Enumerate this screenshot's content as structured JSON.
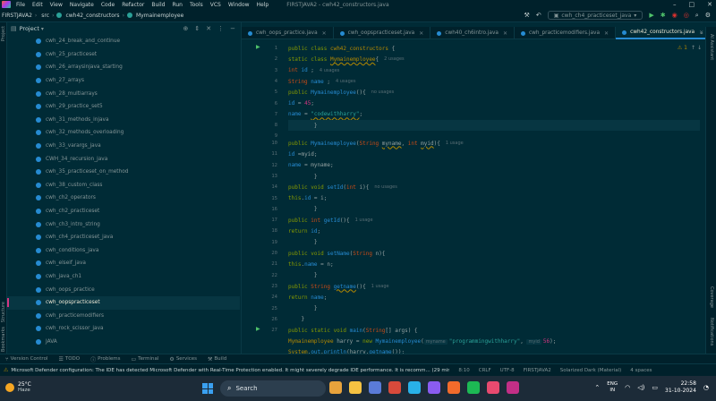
{
  "menubar": {
    "items": [
      "File",
      "Edit",
      "View",
      "Navigate",
      "Code",
      "Refactor",
      "Build",
      "Run",
      "Tools",
      "VCS",
      "Window",
      "Help"
    ],
    "title": "FIRSTJAVA2 - cwh42_constructors.java",
    "controls": [
      "–",
      "□",
      "✕"
    ]
  },
  "navbar": {
    "crumbs": [
      "FIRSTJAVA2",
      "src",
      "cwh42_constructors",
      "Mymainemployee"
    ],
    "run_config": "cwh_ch4_practiceset_java"
  },
  "left_stripe": {
    "project_label": "Project",
    "structure_label": "Structure",
    "bookmarks_label": "Bookmarks"
  },
  "project": {
    "title": "Project",
    "items": [
      "cwh_24_break_and_continue",
      "cwh_25_practiceset",
      "cwh_26_arraysinjava_starting",
      "cwh_27_arrays",
      "cwh_28_multiarrays",
      "cwh_29_practice_set5",
      "cwh_31_methods_injava",
      "cwh_32_methods_overloading",
      "cwh_33_varargs_java",
      "CWH_34_recursion_java",
      "cwh_35_practiceset_on_method",
      "cwh_38_custom_class",
      "cwh_ch2_operators",
      "cwh_ch2_practiceset",
      "cwh_ch3_intro_string",
      "cwh_ch4_practiceset_java",
      "cwh_conditions_java",
      "cwh_elseif_java",
      "cwh_java_ch1",
      "cwh_oops_practice",
      "cwh_oopspracticeset",
      "cwh_practicemodifiers",
      "cwh_rock_scissor_java",
      "JAVA"
    ],
    "selected_index": 20
  },
  "tabs": [
    {
      "label": "cwh_oops_practice.java",
      "active": false
    },
    {
      "label": "cwh_oopspracticeset.java",
      "active": false
    },
    {
      "label": "cwh40_ch6intro.java",
      "active": false
    },
    {
      "label": "cwh_practicemodifiers.java",
      "active": false
    },
    {
      "label": "cwh42_constructors.java",
      "active": true
    }
  ],
  "editor": {
    "line_numbers": [
      "1",
      "2",
      "3",
      "4",
      "5",
      "6",
      "7",
      "8",
      "9",
      "10",
      "11",
      "12",
      "13",
      "14",
      "15",
      "16",
      "17",
      "18",
      "19",
      "20",
      "21",
      "22",
      "23",
      "24",
      "25",
      "26",
      "27"
    ],
    "warning_count": "1",
    "hints": {
      "usages2": "2 usages",
      "usages4": "4 usages",
      "usages4b": "4 usages",
      "nousages": "no usages",
      "usage1": "1 usage",
      "nousages2": "no usages",
      "usage1b": "1 usage",
      "usage1c": "1 usage",
      "usage1d": "1 usage",
      "pname": "myname",
      "pid": "myid"
    },
    "strings": {
      "codewithharry": "\"codewithharry\"",
      "programmingwithharry": "\"programmingwithharry\""
    },
    "numbers": {
      "n45": "45",
      "n56": "56"
    }
  },
  "right_stripe": {
    "ai": "AI Assistant",
    "coverage": "Coverage",
    "notifications": "Notifications"
  },
  "toolwindows": [
    "Version Control",
    "TODO",
    "Problems",
    "Terminal",
    "Services",
    "Build"
  ],
  "status": {
    "message": "Microsoft Defender configuration: The IDE has detected Microsoft Defender with Real-Time Protection enabled. It might severely degrade IDE performance. It is recomm... (29 mins",
    "position": "8:10",
    "line_sep": "CRLF",
    "encoding": "UTF-8",
    "project": "FIRSTJAVA2",
    "theme": "Solarized Dark (Material)",
    "indent": "4 spaces"
  },
  "taskbar": {
    "temp": "25°C",
    "condition": "Haze",
    "search_placeholder": "Search",
    "lang_top": "ENG",
    "lang_bottom": "IN",
    "time": "22:58",
    "date": "31-10-2024",
    "app_colors": [
      "#e8a33c",
      "#f5c242",
      "#5a7bd8",
      "#d84a3b",
      "#29b1e8",
      "#8a5cf0",
      "#f26b2b",
      "#1db954",
      "#e84a6f",
      "#c22f86"
    ]
  }
}
